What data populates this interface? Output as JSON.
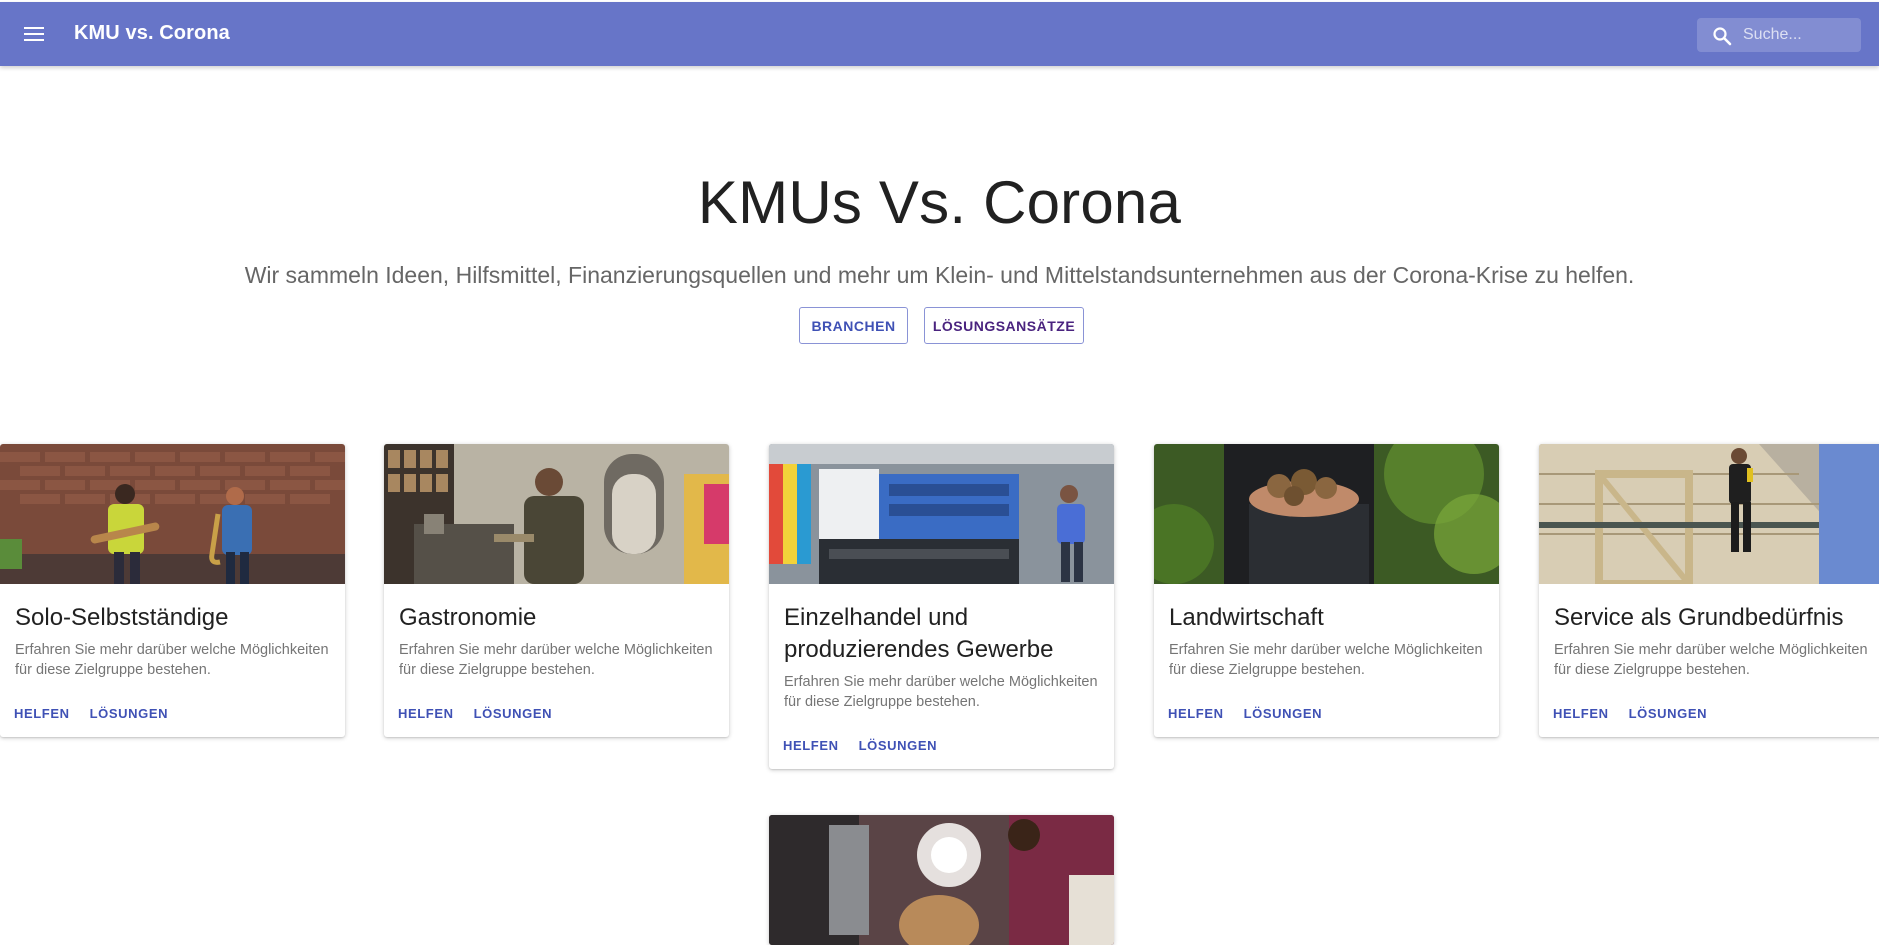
{
  "app": {
    "title": "KMU vs. Corona"
  },
  "search": {
    "placeholder": "Suche..."
  },
  "hero": {
    "title": "KMUs Vs. Corona",
    "subtitle": "Wir sammeln Ideen, Hilfsmittel, Finanzierungsquellen und mehr um Klein- und Mittelstandsunternehmen aus der Corona-Krise zu helfen.",
    "buttons": {
      "branchen": "BRANCHEN",
      "loesungen": "LÖSUNGSANSÄTZE"
    }
  },
  "cards": [
    {
      "title": "Solo-Selbstständige",
      "desc": "Erfahren Sie mehr darüber welche Möglichkeiten für diese Zielgruppe bestehen.",
      "help": "HELFEN",
      "solutions": "LÖSUNGEN"
    },
    {
      "title": "Gastronomie",
      "desc": "Erfahren Sie mehr darüber welche Möglichkeiten für diese Zielgruppe bestehen.",
      "help": "HELFEN",
      "solutions": "LÖSUNGEN"
    },
    {
      "title": "Einzelhandel und produzierendes Gewerbe",
      "desc": "Erfahren Sie mehr darüber welche Möglichkeiten für diese Zielgruppe bestehen.",
      "help": "HELFEN",
      "solutions": "LÖSUNGEN"
    },
    {
      "title": "Landwirtschaft",
      "desc": "Erfahren Sie mehr darüber welche Möglichkeiten für diese Zielgruppe bestehen.",
      "help": "HELFEN",
      "solutions": "LÖSUNGEN"
    },
    {
      "title": "Service als Grundbedürfnis",
      "desc": "Erfahren Sie mehr darüber welche Möglichkeiten für diese Zielgruppe bestehen.",
      "help": "HELFEN",
      "solutions": "LÖSUNGEN"
    }
  ],
  "icons": {
    "menu": "menu-icon",
    "search": "search-icon"
  },
  "colors": {
    "appbar": "#6775c8",
    "primary": "#3f51b5",
    "secondary": "#4a237f"
  }
}
